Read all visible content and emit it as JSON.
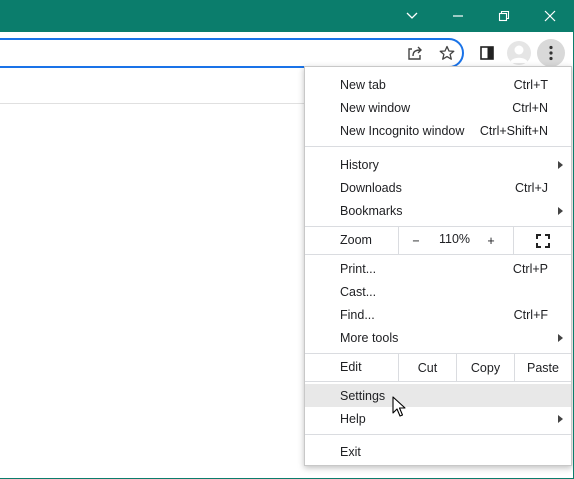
{
  "window": {
    "icons": {
      "tab_search": "chevron-down-icon",
      "minimize": "minimize-icon",
      "restore": "restore-icon",
      "close": "close-icon"
    },
    "colors": {
      "titlebar": "#0b7d6c",
      "omnibox_focus": "#1a73e8",
      "highlight": "#e8e8e8"
    }
  },
  "toolbar": {
    "icons": [
      "share-icon",
      "star-icon",
      "side-panel-icon",
      "profile-avatar",
      "more-menu-icon"
    ]
  },
  "menu": {
    "group1": [
      {
        "label": "New tab",
        "shortcut": "Ctrl+T"
      },
      {
        "label": "New window",
        "shortcut": "Ctrl+N"
      },
      {
        "label": "New Incognito window",
        "shortcut": "Ctrl+Shift+N"
      }
    ],
    "group2": [
      {
        "label": "History",
        "shortcut": ""
      },
      {
        "label": "Downloads",
        "shortcut": "Ctrl+J"
      },
      {
        "label": "Bookmarks",
        "shortcut": ""
      }
    ],
    "zoom": {
      "label": "Zoom",
      "minus": "−",
      "value": "110%",
      "plus": "+"
    },
    "group3": [
      {
        "label": "Print...",
        "shortcut": "Ctrl+P"
      },
      {
        "label": "Cast...",
        "shortcut": ""
      },
      {
        "label": "Find...",
        "shortcut": "Ctrl+F"
      },
      {
        "label": "More tools",
        "shortcut": ""
      }
    ],
    "edit": {
      "label": "Edit",
      "cut": "Cut",
      "copy": "Copy",
      "paste": "Paste"
    },
    "group4": [
      {
        "label": "Settings"
      },
      {
        "label": "Help"
      }
    ],
    "exit": {
      "label": "Exit"
    }
  }
}
